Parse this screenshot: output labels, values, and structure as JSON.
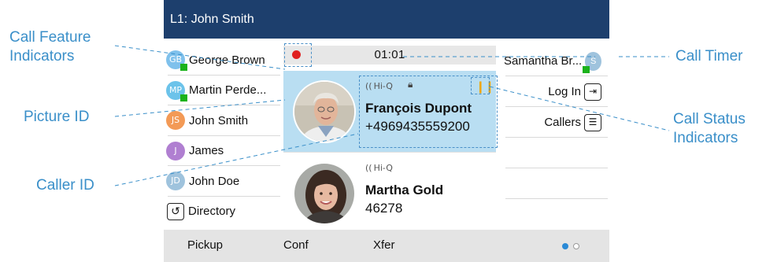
{
  "titlebar": {
    "line_label": "L1: John Smith"
  },
  "contacts": [
    {
      "initials": "GB",
      "name": "George Brown",
      "color": "#7fc1ec",
      "online": true
    },
    {
      "initials": "MP",
      "name": "Martin Perde...",
      "color": "#6cc3ea",
      "online": true
    },
    {
      "initials": "JS",
      "name": "John Smith",
      "color": "#f39a56",
      "online": false
    },
    {
      "initials": "J",
      "name": "James",
      "color": "#b07fd1",
      "online": false
    },
    {
      "initials": "JD",
      "name": "John Doe",
      "color": "#9fc3dd",
      "online": false
    }
  ],
  "directory": {
    "label": "Directory",
    "icon": "history-icon"
  },
  "call_timer": {
    "value": "01:01",
    "recording": true
  },
  "calls": [
    {
      "name": "François Dupont",
      "number": "+4969435559200",
      "hd_badge": "Hi-Q",
      "locked": true,
      "on_hold": true,
      "active": true
    },
    {
      "name": "Martha Gold",
      "number": "46278",
      "hd_badge": "Hi-Q",
      "locked": false,
      "on_hold": false,
      "active": false
    }
  ],
  "right_keys": {
    "speed_dial": {
      "label": "Samantha Br...",
      "initials": "S",
      "online": true
    },
    "login": {
      "label": "Log In",
      "icon": "login-icon"
    },
    "callers": {
      "label": "Callers",
      "icon": "callers-icon"
    }
  },
  "softkeys": {
    "pickup": "Pickup",
    "conf": "Conf",
    "xfer": "Xfer"
  },
  "page_indicator": {
    "current": 1,
    "total": 2
  },
  "callouts": {
    "call_feature": "Call Feature\nIndicators",
    "picture_id": "Picture ID",
    "caller_id": "Caller ID",
    "call_timer": "Call Timer",
    "call_status": "Call Status\nIndicators"
  },
  "colors": {
    "accent": "#3a8fc9",
    "titlebar": "#1d3f6d",
    "active_call": "#b9def2",
    "presence_online": "#1bb21b",
    "hold": "#f0a500"
  }
}
